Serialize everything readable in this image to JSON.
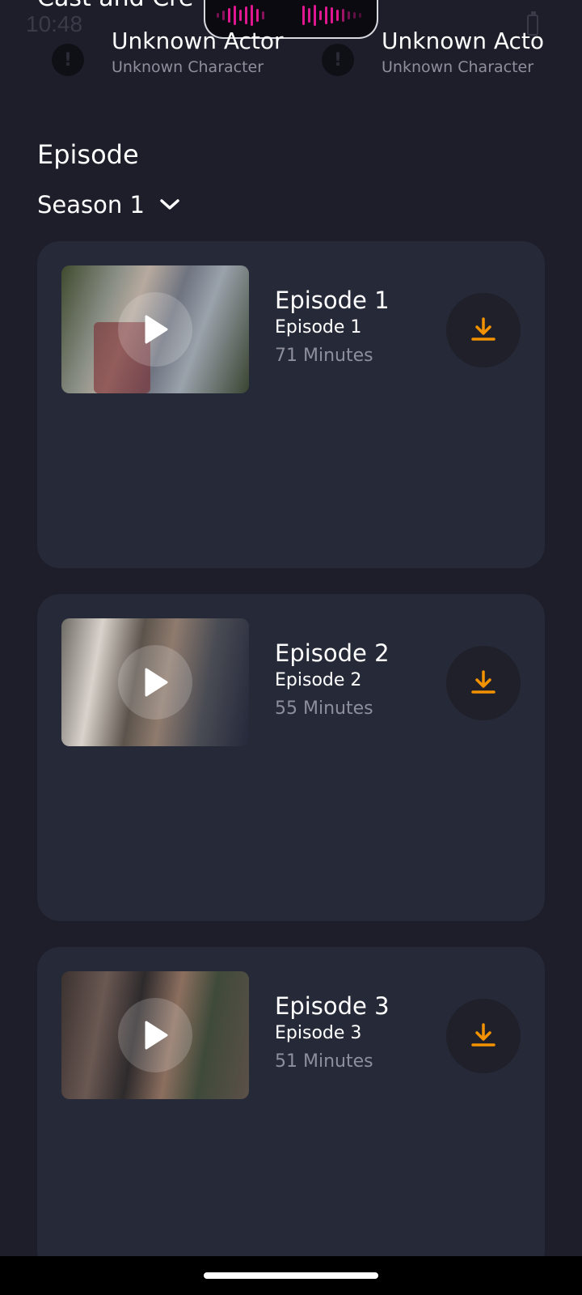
{
  "status_bar": {
    "time": "10:48"
  },
  "cast_section": {
    "title": "Cast and Cre",
    "items": [
      {
        "actor": "Unknown Actor",
        "character": "Unknown Character",
        "icon": "alert-icon"
      },
      {
        "actor": "Unknown Acto",
        "character": "Unknown Character",
        "icon": "alert-icon"
      }
    ]
  },
  "episodes_section": {
    "title": "Episode",
    "season_selector": {
      "value": "Season 1",
      "icon": "chevron-down-icon"
    },
    "episodes": [
      {
        "title": "Episode 1",
        "subtitle": "Episode 1",
        "duration": "71 Minutes"
      },
      {
        "title": "Episode 2",
        "subtitle": "Episode 2",
        "duration": "55 Minutes"
      },
      {
        "title": "Episode 3",
        "subtitle": "Episode 3",
        "duration": "51 Minutes"
      }
    ]
  },
  "colors": {
    "background": "#1d1e2a",
    "card": "#262938",
    "accent": "#f39200",
    "muted_text": "#8d8f9c"
  }
}
